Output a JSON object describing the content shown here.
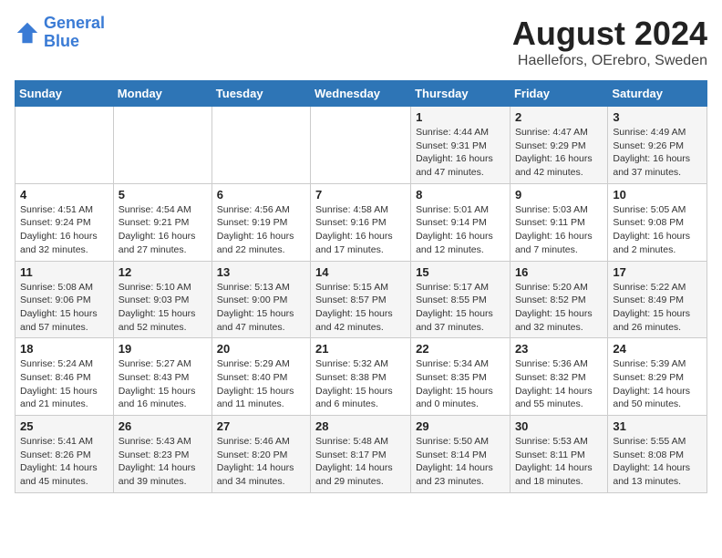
{
  "logo": {
    "line1": "General",
    "line2": "Blue"
  },
  "title": "August 2024",
  "subtitle": "Haellefors, OErebro, Sweden",
  "days_of_week": [
    "Sunday",
    "Monday",
    "Tuesday",
    "Wednesday",
    "Thursday",
    "Friday",
    "Saturday"
  ],
  "weeks": [
    [
      {
        "day": "",
        "info": ""
      },
      {
        "day": "",
        "info": ""
      },
      {
        "day": "",
        "info": ""
      },
      {
        "day": "",
        "info": ""
      },
      {
        "day": "1",
        "info": "Sunrise: 4:44 AM\nSunset: 9:31 PM\nDaylight: 16 hours\nand 47 minutes."
      },
      {
        "day": "2",
        "info": "Sunrise: 4:47 AM\nSunset: 9:29 PM\nDaylight: 16 hours\nand 42 minutes."
      },
      {
        "day": "3",
        "info": "Sunrise: 4:49 AM\nSunset: 9:26 PM\nDaylight: 16 hours\nand 37 minutes."
      }
    ],
    [
      {
        "day": "4",
        "info": "Sunrise: 4:51 AM\nSunset: 9:24 PM\nDaylight: 16 hours\nand 32 minutes."
      },
      {
        "day": "5",
        "info": "Sunrise: 4:54 AM\nSunset: 9:21 PM\nDaylight: 16 hours\nand 27 minutes."
      },
      {
        "day": "6",
        "info": "Sunrise: 4:56 AM\nSunset: 9:19 PM\nDaylight: 16 hours\nand 22 minutes."
      },
      {
        "day": "7",
        "info": "Sunrise: 4:58 AM\nSunset: 9:16 PM\nDaylight: 16 hours\nand 17 minutes."
      },
      {
        "day": "8",
        "info": "Sunrise: 5:01 AM\nSunset: 9:14 PM\nDaylight: 16 hours\nand 12 minutes."
      },
      {
        "day": "9",
        "info": "Sunrise: 5:03 AM\nSunset: 9:11 PM\nDaylight: 16 hours\nand 7 minutes."
      },
      {
        "day": "10",
        "info": "Sunrise: 5:05 AM\nSunset: 9:08 PM\nDaylight: 16 hours\nand 2 minutes."
      }
    ],
    [
      {
        "day": "11",
        "info": "Sunrise: 5:08 AM\nSunset: 9:06 PM\nDaylight: 15 hours\nand 57 minutes."
      },
      {
        "day": "12",
        "info": "Sunrise: 5:10 AM\nSunset: 9:03 PM\nDaylight: 15 hours\nand 52 minutes."
      },
      {
        "day": "13",
        "info": "Sunrise: 5:13 AM\nSunset: 9:00 PM\nDaylight: 15 hours\nand 47 minutes."
      },
      {
        "day": "14",
        "info": "Sunrise: 5:15 AM\nSunset: 8:57 PM\nDaylight: 15 hours\nand 42 minutes."
      },
      {
        "day": "15",
        "info": "Sunrise: 5:17 AM\nSunset: 8:55 PM\nDaylight: 15 hours\nand 37 minutes."
      },
      {
        "day": "16",
        "info": "Sunrise: 5:20 AM\nSunset: 8:52 PM\nDaylight: 15 hours\nand 32 minutes."
      },
      {
        "day": "17",
        "info": "Sunrise: 5:22 AM\nSunset: 8:49 PM\nDaylight: 15 hours\nand 26 minutes."
      }
    ],
    [
      {
        "day": "18",
        "info": "Sunrise: 5:24 AM\nSunset: 8:46 PM\nDaylight: 15 hours\nand 21 minutes."
      },
      {
        "day": "19",
        "info": "Sunrise: 5:27 AM\nSunset: 8:43 PM\nDaylight: 15 hours\nand 16 minutes."
      },
      {
        "day": "20",
        "info": "Sunrise: 5:29 AM\nSunset: 8:40 PM\nDaylight: 15 hours\nand 11 minutes."
      },
      {
        "day": "21",
        "info": "Sunrise: 5:32 AM\nSunset: 8:38 PM\nDaylight: 15 hours\nand 6 minutes."
      },
      {
        "day": "22",
        "info": "Sunrise: 5:34 AM\nSunset: 8:35 PM\nDaylight: 15 hours\nand 0 minutes."
      },
      {
        "day": "23",
        "info": "Sunrise: 5:36 AM\nSunset: 8:32 PM\nDaylight: 14 hours\nand 55 minutes."
      },
      {
        "day": "24",
        "info": "Sunrise: 5:39 AM\nSunset: 8:29 PM\nDaylight: 14 hours\nand 50 minutes."
      }
    ],
    [
      {
        "day": "25",
        "info": "Sunrise: 5:41 AM\nSunset: 8:26 PM\nDaylight: 14 hours\nand 45 minutes."
      },
      {
        "day": "26",
        "info": "Sunrise: 5:43 AM\nSunset: 8:23 PM\nDaylight: 14 hours\nand 39 minutes."
      },
      {
        "day": "27",
        "info": "Sunrise: 5:46 AM\nSunset: 8:20 PM\nDaylight: 14 hours\nand 34 minutes."
      },
      {
        "day": "28",
        "info": "Sunrise: 5:48 AM\nSunset: 8:17 PM\nDaylight: 14 hours\nand 29 minutes."
      },
      {
        "day": "29",
        "info": "Sunrise: 5:50 AM\nSunset: 8:14 PM\nDaylight: 14 hours\nand 23 minutes."
      },
      {
        "day": "30",
        "info": "Sunrise: 5:53 AM\nSunset: 8:11 PM\nDaylight: 14 hours\nand 18 minutes."
      },
      {
        "day": "31",
        "info": "Sunrise: 5:55 AM\nSunset: 8:08 PM\nDaylight: 14 hours\nand 13 minutes."
      }
    ]
  ]
}
